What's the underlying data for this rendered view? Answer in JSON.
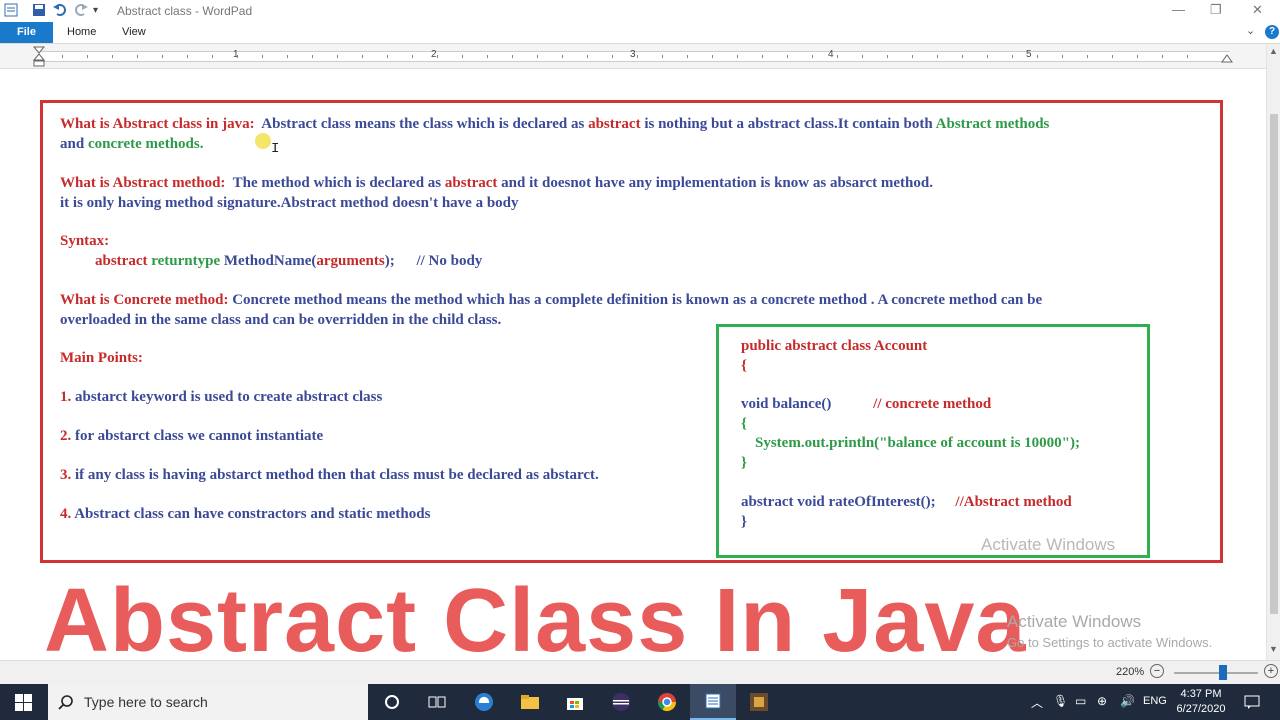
{
  "window": {
    "title": "Abstract class - WordPad",
    "minimize_glyph": "—",
    "restore_glyph": "❐",
    "close_glyph": "✕"
  },
  "ribbon": {
    "tabs": [
      "File",
      "Home",
      "View"
    ],
    "help_glyph": "?",
    "collapse_glyph": "⌄"
  },
  "ruler": {
    "numbers": [
      "1",
      "2",
      "3",
      "4",
      "5"
    ]
  },
  "document": {
    "q1_label": "What is Abstract class in java:",
    "q1_a": "Abstract class means the class which is declared as",
    "q1_kw": "abstract",
    "q1_b": "is nothing but a abstract class.It contain both",
    "q1_c": "Abstract methods",
    "q1_and": "and",
    "q1_d": "concrete methods.",
    "q2_label": "What is Abstract method:",
    "q2_a": "The method which is declared as",
    "q2_kw": "abstract",
    "q2_b": "and it doesnot have any implementation is know as absarct method.",
    "q2_line2": "it is only having method signature.Abstract method doesn't have a body",
    "syntax_label": "Syntax:",
    "syntax_abstract": "abstract",
    "syntax_returntype": "returntype",
    "syntax_name": "MethodName(",
    "syntax_args": "arguments",
    "syntax_close": ");",
    "syntax_comment": "// No body",
    "q3_label": "What is Concrete method:",
    "q3_a": "Concrete  method means the method which has a complete definition is known as a concrete method . A concrete method can be",
    "q3_line2": "overloaded in the same class and can be overridden in the child class.",
    "main_points_label": "Main Points:",
    "points": [
      {
        "num": "1.",
        "text": "abstarct keyword is used to create abstract class"
      },
      {
        "num": "2.",
        "text": "for abstarct class we cannot instantiate"
      },
      {
        "num": "3.",
        "text": "if any class is having abstarct method then that class must be declared as abstarct."
      },
      {
        "num": "4.",
        "text": "Abstract class can have constractors and static methods"
      }
    ]
  },
  "code": {
    "line1": "public abstract  class Account",
    "open1": "{",
    "line3": "void balance()",
    "comment3": "// concrete method",
    "open2": "{",
    "line5": "System.out.println(\"balance of account is 10000\");",
    "close2": "}",
    "line7": "abstract void rateOfInterest();",
    "comment7": "//Abstract method",
    "close1": "}"
  },
  "overlay": {
    "big_title": "Abstract Class  In Java",
    "watermark_inner": "Activate Windows",
    "watermark_title": "Activate Windows",
    "watermark_sub": "Go to Settings to activate Windows."
  },
  "statusbar": {
    "zoom": "220%",
    "minus": "−",
    "plus": "+"
  },
  "taskbar": {
    "search_placeholder": "Type here to search",
    "lang": "ENG",
    "time": "4:37 PM",
    "date": "6/27/2020"
  },
  "colors": {
    "red": "#c62a2a",
    "blue": "#3b4a97",
    "green": "#2e9a48",
    "title_red": "#e85c5c",
    "file_blue": "#1979ca"
  }
}
